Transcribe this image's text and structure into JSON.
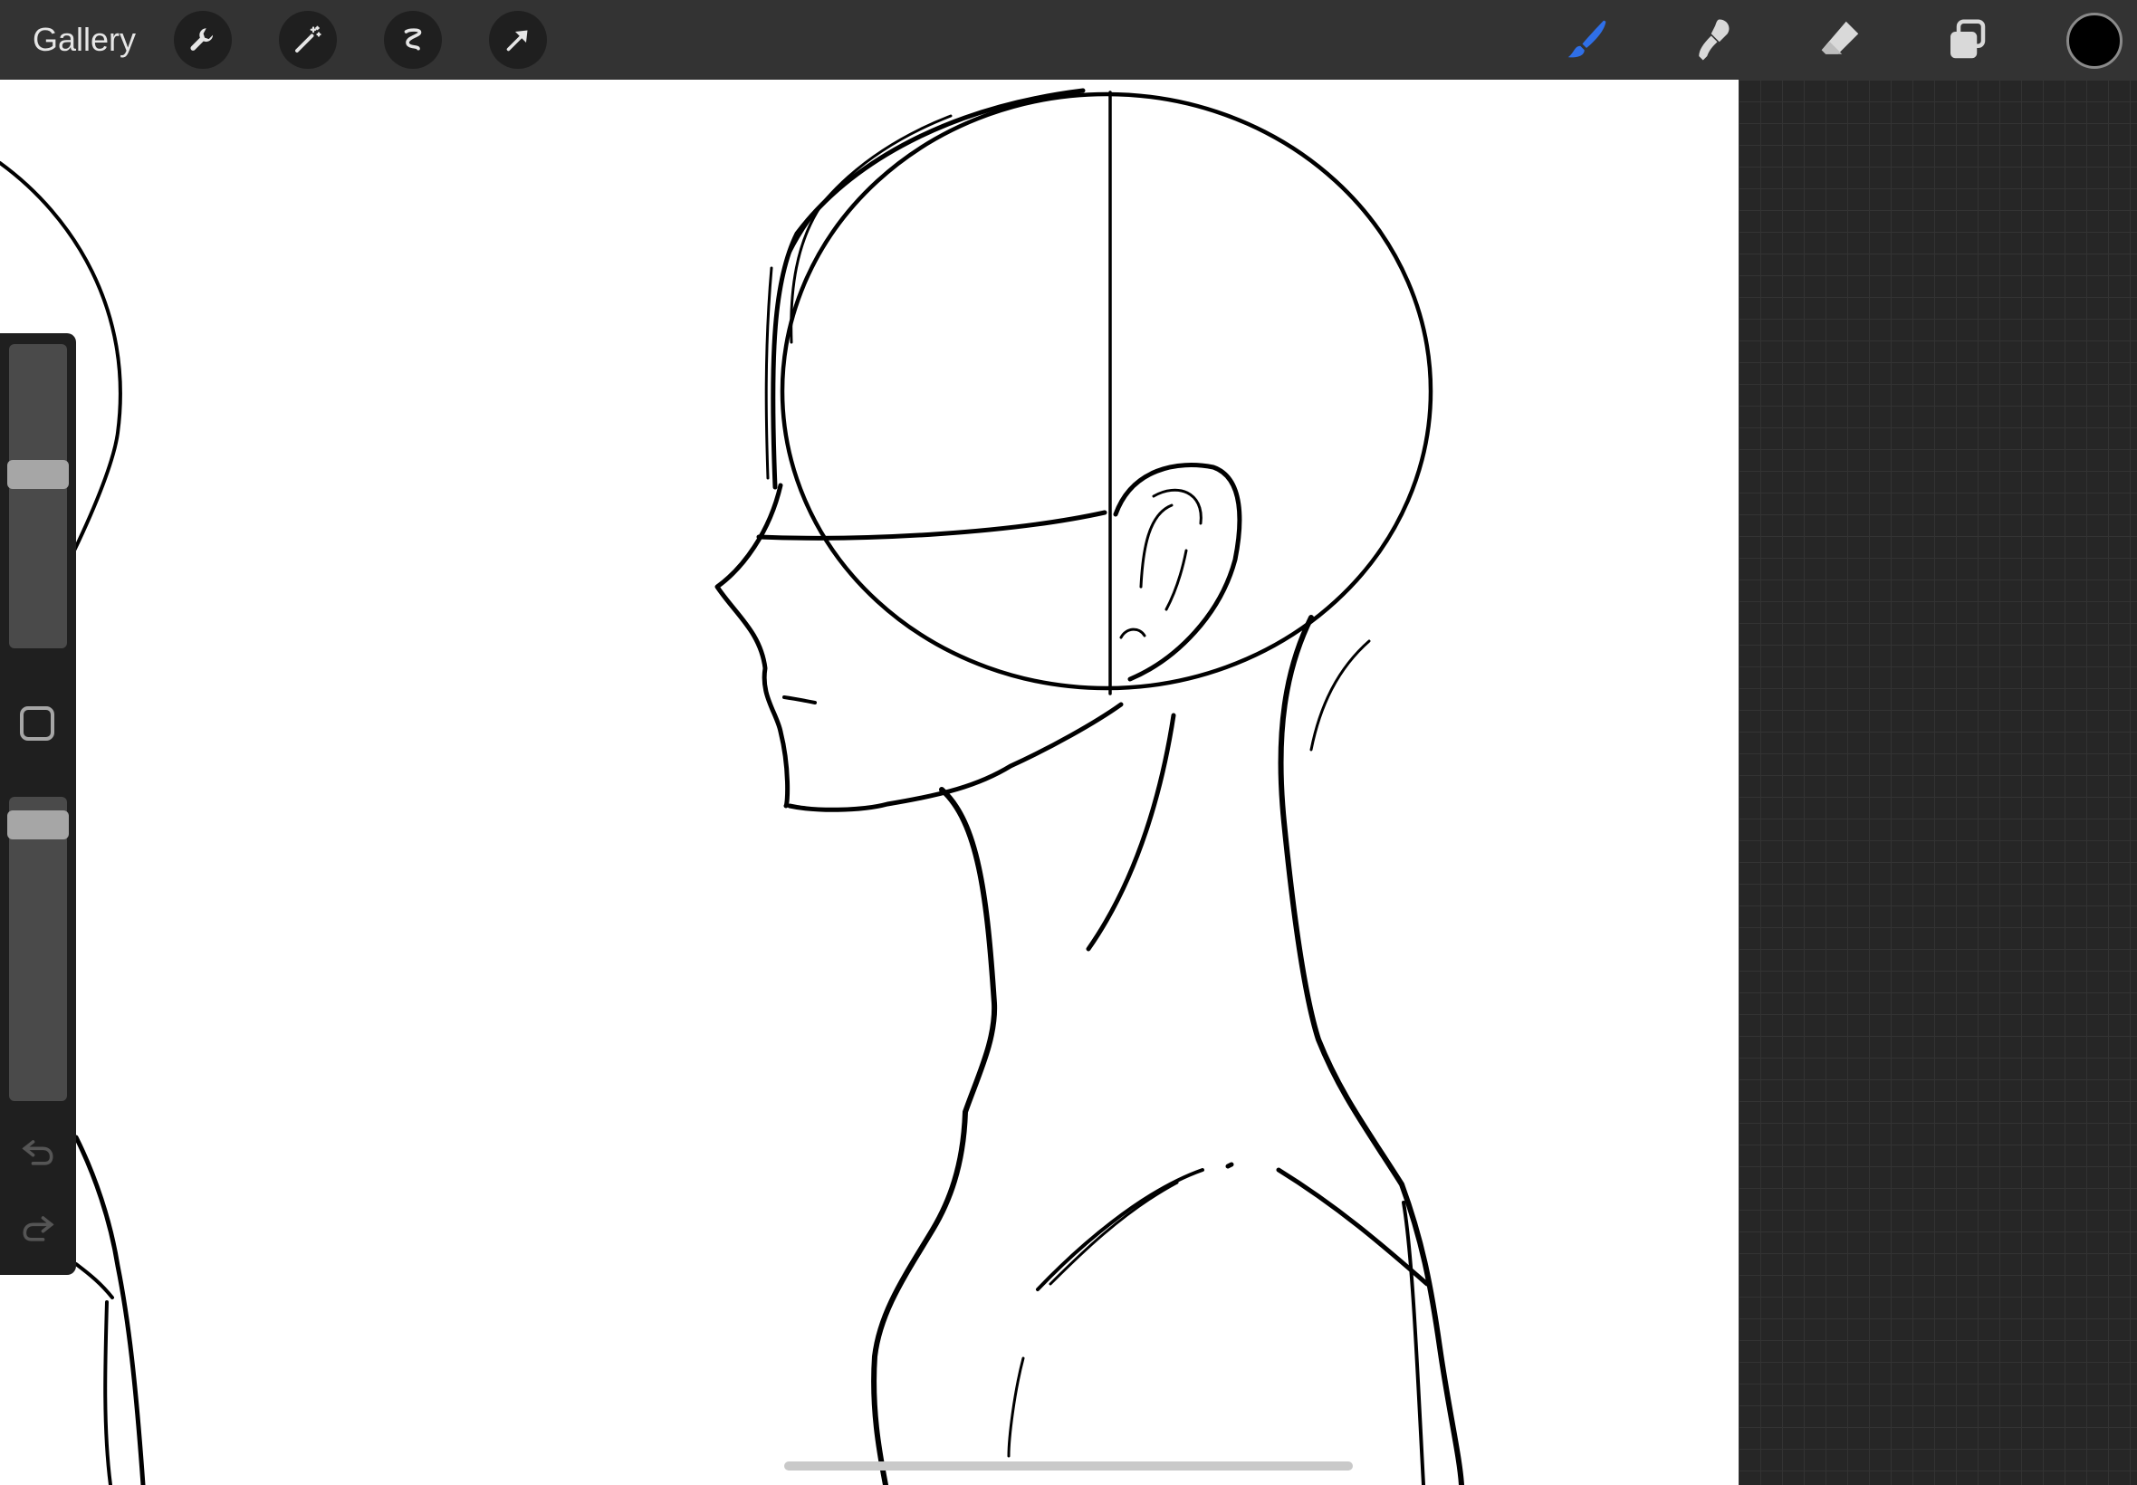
{
  "topbar": {
    "gallery_label": "Gallery",
    "left_tools": [
      "wrench-icon",
      "magic-wand-icon",
      "selection-icon",
      "transform-arrow-icon"
    ],
    "right_tools": [
      "brush-icon",
      "smudge-icon",
      "eraser-icon",
      "layers-icon"
    ],
    "active_tool": "brush-icon",
    "active_color": "#000000",
    "accent_color": "#2f6fe8"
  },
  "sidebar": {
    "brush_size_level": 0.58,
    "brush_opacity_level": 0.95,
    "icons": [
      "modify-square-icon",
      "undo-icon",
      "redo-icon"
    ]
  },
  "canvas": {
    "background": "#ffffff",
    "content": "sketch-line-art"
  }
}
